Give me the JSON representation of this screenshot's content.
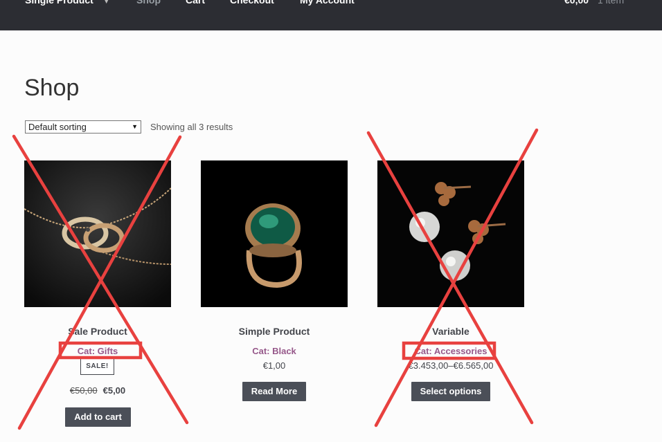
{
  "nav": {
    "items": [
      {
        "label": "Single Product"
      },
      {
        "label": "Shop"
      },
      {
        "label": "Cart"
      },
      {
        "label": "Checkout"
      },
      {
        "label": "My Account"
      }
    ],
    "cart_total": "€0,00",
    "cart_count": "1 item"
  },
  "page": {
    "title": "Shop"
  },
  "toolbar": {
    "sorting_selected": "Default sorting",
    "result_count": "Showing all 3 results"
  },
  "products": [
    {
      "name": "Sale Product",
      "category": "Cat: Gifts",
      "sale_badge": "SALE!",
      "old_price": "€50,00",
      "price": "€5,00",
      "button": "Add to cart"
    },
    {
      "name": "Simple Product",
      "category": "Cat: Black",
      "price": "€1,00",
      "button": "Read More"
    },
    {
      "name": "Variable",
      "category": "Cat: Accessories",
      "price": "€3.453,00–€6.565,00",
      "button": "Select options"
    }
  ],
  "colors": {
    "header_bg": "#2c2d33",
    "category_link": "#96588a",
    "button_bg": "#4b4f58",
    "annotation_red": "#e8413f"
  },
  "icons": {
    "dropdown": "chevron-down-icon",
    "sort_arrow": "triangle-down-icon"
  }
}
